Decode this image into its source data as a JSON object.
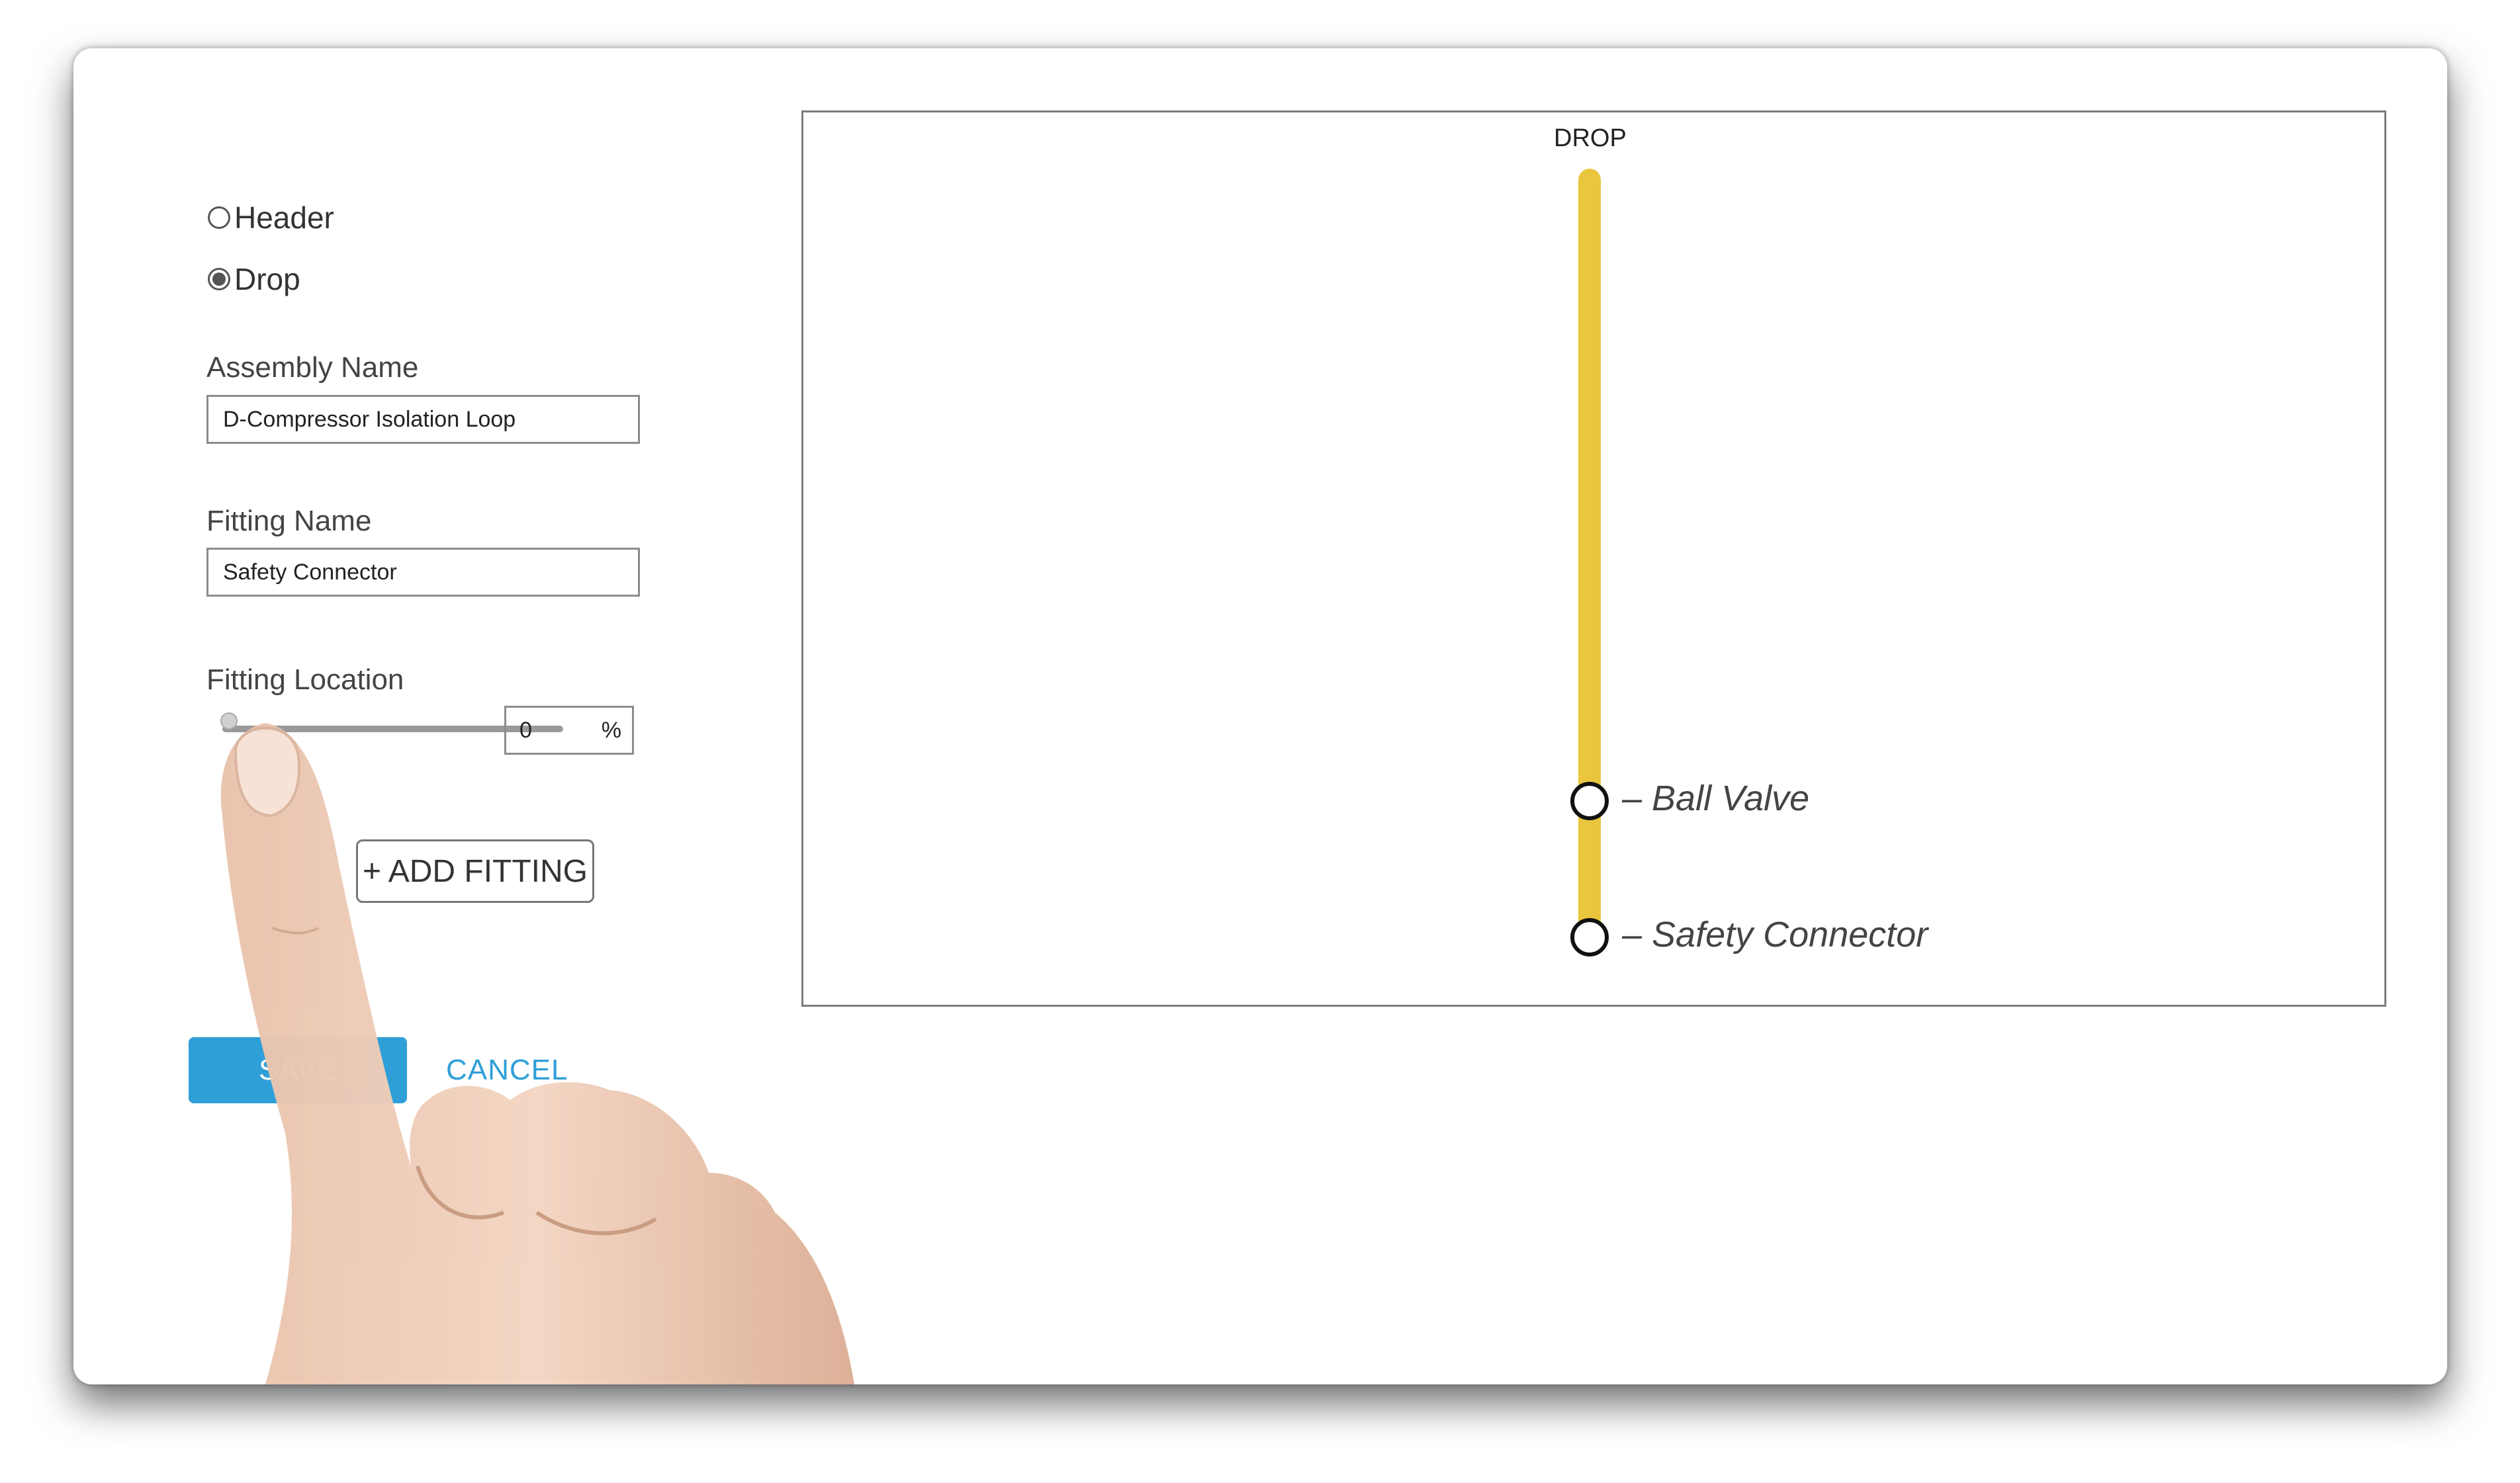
{
  "form": {
    "type_options": [
      {
        "label": "Header",
        "selected": false
      },
      {
        "label": "Drop",
        "selected": true
      }
    ],
    "assembly_name": {
      "label": "Assembly Name",
      "value": "D-Compressor Isolation Loop"
    },
    "fitting_name": {
      "label": "Fitting Name",
      "value": "Safety Connector"
    },
    "fitting_location": {
      "label": "Fitting Location",
      "value": "0",
      "unit": "%",
      "slider_fraction": 0.0
    },
    "add_fitting_label": "+ ADD FITTING",
    "save_label": "SAVE",
    "cancel_label": "CANCEL"
  },
  "diagram": {
    "title": "DROP",
    "pipe_color": "#eac63e",
    "fittings": [
      {
        "label": "– Ball Valve"
      },
      {
        "label": "– Safety Connector"
      }
    ]
  },
  "colors": {
    "accent": "#2f9fd8",
    "pipe": "#eac63e"
  }
}
